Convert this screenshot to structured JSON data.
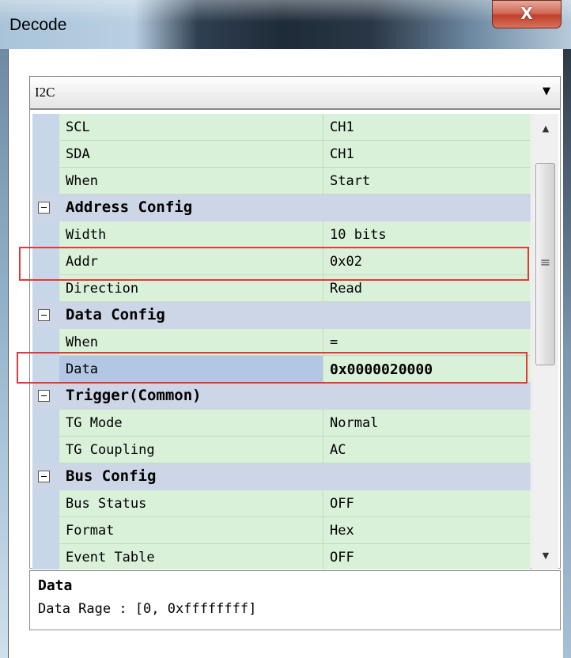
{
  "window": {
    "title": "Decode",
    "close_label": "X"
  },
  "decode": {
    "protocol": "I2C"
  },
  "rows": {
    "scl": {
      "name": "SCL",
      "value": "CH1"
    },
    "sda": {
      "name": "SDA",
      "value": "CH1"
    },
    "when": {
      "name": "When",
      "value": "Start"
    },
    "address_config": "Address Config",
    "width": {
      "name": "Width",
      "value": "10 bits"
    },
    "addr": {
      "name": "Addr",
      "value": "0x02"
    },
    "direction": {
      "name": "Direction",
      "value": "Read"
    },
    "data_config": "Data Config",
    "data_when": {
      "name": "When",
      "value": "="
    },
    "data": {
      "name": "Data",
      "value": "0x0000020000"
    },
    "trigger_common": "Trigger(Common)",
    "tg_mode": {
      "name": "TG Mode",
      "value": "Normal"
    },
    "tg_coupling": {
      "name": "TG Coupling",
      "value": "AC"
    },
    "bus_config": "Bus Config",
    "bus_status": {
      "name": "Bus Status",
      "value": "OFF"
    },
    "format": {
      "name": "Format",
      "value": "Hex"
    },
    "event_table": {
      "name": "Event Table",
      "value": "OFF"
    }
  },
  "description": {
    "title": "Data",
    "text": "Data Rage : [0, 0xffffffff]"
  },
  "icons": {
    "scroll_up": "arrow-up-icon",
    "scroll_down": "arrow-down-icon",
    "dropdown": "chevron-down-icon",
    "collapse": "minus-box-icon",
    "grip": "scroll-grip-icon"
  },
  "colors": {
    "property_row": "#d9f0d9",
    "category_row": "#cdd6e6",
    "selected_name": "#b3c7e4",
    "highlight_box": "#e3393a"
  }
}
